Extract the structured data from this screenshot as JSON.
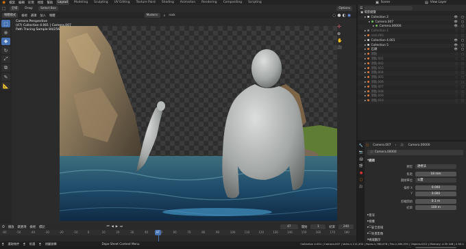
{
  "topbar": {
    "menus": [
      "檔案",
      "編輯",
      "彩現",
      "視窗",
      "幫助"
    ],
    "workspaces": [
      "Layout",
      "Modeling",
      "Sculpting",
      "UV Editing",
      "Texture Paint",
      "Shading",
      "Animation",
      "Rendering",
      "Compositing",
      "Scripting"
    ],
    "scene_label": "Scene",
    "view_layer_label": "View Layer"
  },
  "header": {
    "mode": "物體模式",
    "view": "檢視",
    "select": "選擇",
    "add": "加入",
    "object": "物體",
    "orientation": "全域",
    "drag": "Drag:",
    "select_box": "Select Box",
    "options": "Options",
    "gizmo": "Moderic",
    "search": "rock"
  },
  "overlay": {
    "line1": "Camera Perspective",
    "line2": "(47) Collection 4.001 | Camera.007",
    "line3": "Path Tracing Sample 84/256"
  },
  "outliner": {
    "title": "場景總覽",
    "items": [
      {
        "label": "Collection 2",
        "indent": 1,
        "color": "#d9d9d9",
        "on": true
      },
      {
        "label": "Camera.007",
        "indent": 2,
        "color": "#6fbf5d",
        "on": true
      },
      {
        "label": "Camera.00000",
        "indent": 3,
        "color": "#6fbf5d",
        "on": true
      },
      {
        "label": "Collection 1",
        "indent": 1,
        "color": "#888888",
        "on": false
      },
      {
        "label": "rock.001",
        "indent": 1,
        "color": "#e07a3a",
        "on": false
      },
      {
        "label": "Collection 4.001",
        "indent": 1,
        "color": "#d9d9d9",
        "on": true
      },
      {
        "label": "Collection 5",
        "indent": 1,
        "color": "#d9d9d9",
        "on": true
      },
      {
        "label": "石頭",
        "indent": 1,
        "color": "#e07a3a",
        "on": true
      },
      {
        "label": "頂點",
        "indent": 1,
        "color": "#e07a3a",
        "on": false
      },
      {
        "label": "頂點.001",
        "indent": 1,
        "color": "#e07a3a",
        "on": false
      },
      {
        "label": "頂點.002",
        "indent": 1,
        "color": "#e07a3a",
        "on": false
      },
      {
        "label": "頂點.003",
        "indent": 1,
        "color": "#e07a3a",
        "on": false
      },
      {
        "label": "頂點.004",
        "indent": 1,
        "color": "#e07a3a",
        "on": false
      },
      {
        "label": "頂點.005",
        "indent": 1,
        "color": "#e07a3a",
        "on": false
      },
      {
        "label": "頂點.006",
        "indent": 1,
        "color": "#e07a3a",
        "on": false
      },
      {
        "label": "頂點.007",
        "indent": 1,
        "color": "#e07a3a",
        "on": false
      },
      {
        "label": "頂點.008",
        "indent": 1,
        "color": "#e07a3a",
        "on": false
      },
      {
        "label": "頂點.009",
        "indent": 1,
        "color": "#e07a3a",
        "on": false
      },
      {
        "label": "頂點.010",
        "indent": 1,
        "color": "#e07a3a",
        "on": false
      }
    ]
  },
  "properties": {
    "breadcrumb1": "Camera.007",
    "breadcrumb2": "Camera.00000",
    "object_name": "Camera.00000",
    "section_lens": "鏡頭",
    "type_label": "類型",
    "type_value": "透視法",
    "focal_label": "焦距",
    "focal_value": "18 mm",
    "lens_unit_label": "鏡頭單位",
    "lens_unit_value": "公釐",
    "shift_x_label": "偏移 X",
    "shift_x_value": "0.000",
    "shift_y_label": "Y",
    "shift_y_value": "0.000",
    "clip_start_label": "剪輯開始",
    "clip_start_value": "0.1 m",
    "clip_end_label": "結束",
    "clip_end_value": "100 m",
    "section_dof": "景深",
    "section_camera": "相機",
    "section_safe": "安全區域",
    "section_bg": "背景影像",
    "section_display": "視域顯示",
    "size_label": "大小",
    "size_value": "1 m"
  },
  "timeline": {
    "menus": [
      "播放",
      "鍵選項",
      "檢視",
      "標記"
    ],
    "current_frame": "47",
    "start_label": "開始",
    "start_value": "1",
    "end_label": "結束",
    "end_value": "240",
    "ticks": [
      "-60",
      "-50",
      "-40",
      "-30",
      "-20",
      "-10",
      "0",
      "10",
      "20",
      "30",
      "40",
      "50",
      "60",
      "70",
      "80",
      "90",
      "100",
      "110",
      "120",
      "130",
      "140",
      "150",
      "160",
      "170",
      "180"
    ],
    "playhead_tick": "47"
  },
  "status": {
    "left1": "選取物件",
    "left2": "框選",
    "left3": "視圖旋轉",
    "middle": "Dope Sheet Context Menu",
    "right": "Collection 4.001 | Camera.007 | Verts:1,111,432 | Faces:1,788,078 | Tris:2,285,535 | Objects:0/12 | Memory: 4.55 GiB | 2.90.1"
  }
}
